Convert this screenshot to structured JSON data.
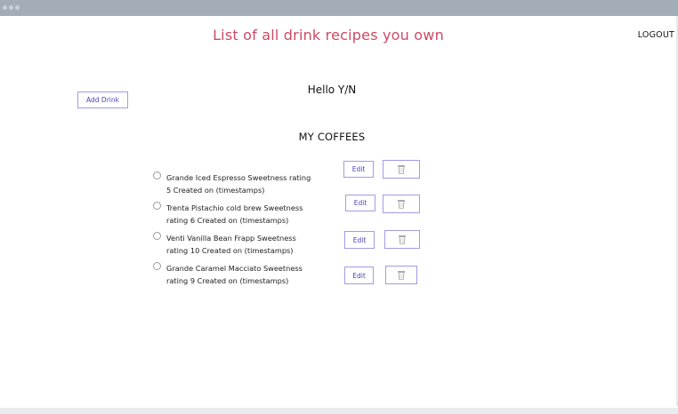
{
  "header": {
    "title": "List of all drink recipes you own",
    "logout_label": "LOGOUT"
  },
  "greeting": "Hello Y/N",
  "add_drink_label": "Add Drink",
  "section_title": "MY COFFEES",
  "edit_label": "Edit",
  "delete_icon": "trash-icon",
  "coffees": [
    {
      "line1": "Grande Iced Espresso Sweetness rating",
      "line2": "5 Created on (timestamps)"
    },
    {
      "line1": "Trenta Pistachio cold brew Sweetness",
      "line2": "rating 6 Created on (timestamps)"
    },
    {
      "line1": "Venti Vanilla Bean Frapp Sweetness",
      "line2": "rating 10 Created on (timestamps)"
    },
    {
      "line1": "Grande Caramel Macciato Sweetness",
      "line2": "rating 9 Created on (timestamps)"
    }
  ],
  "colors": {
    "title": "#cc4a64",
    "button_border": "#a39be6",
    "button_text": "#4b3fc0",
    "titlebar": "#a3adb8"
  }
}
